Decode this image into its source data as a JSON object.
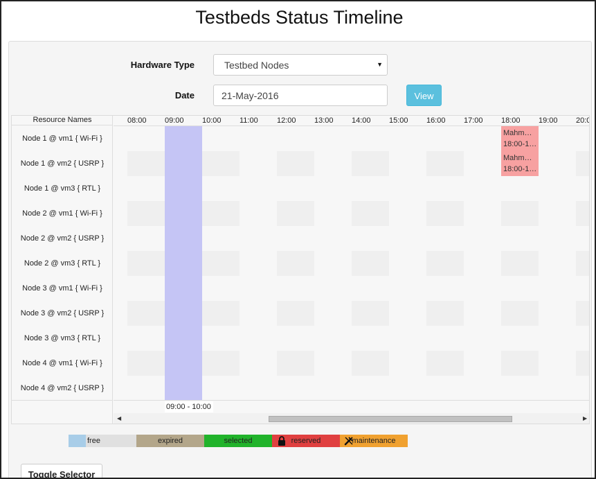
{
  "page": {
    "title": "Testbeds Status Timeline"
  },
  "form": {
    "hardware_type_label": "Hardware Type",
    "hardware_type_value": "Testbed Nodes",
    "date_label": "Date",
    "date_value": "21-May-2016",
    "view_button": "View"
  },
  "timeline": {
    "names_header": "Resource Names",
    "hours": [
      "08:00",
      "09:00",
      "10:00",
      "11:00",
      "12:00",
      "13:00",
      "14:00",
      "15:00",
      "16:00",
      "17:00",
      "18:00",
      "19:00",
      "20:0"
    ],
    "resources": [
      "Node 1 @ vm1 { Wi-Fi }",
      "Node 1 @ vm2 { USRP }",
      "Node 1 @ vm3 { RTL }",
      "Node 2 @ vm1 { Wi-Fi }",
      "Node 2 @ vm2 { USRP }",
      "Node 2 @ vm3 { RTL }",
      "Node 3 @ vm1 { Wi-Fi }",
      "Node 3 @ vm2 { USRP }",
      "Node 3 @ vm3 { RTL }",
      "Node 4 @ vm1 { Wi-Fi }",
      "Node 4 @ vm2 { USRP }"
    ],
    "reservations": [
      {
        "row": 0,
        "owner": "Mahm…",
        "time": "18:00-1…"
      },
      {
        "row": 1,
        "owner": "Mahm…",
        "time": "18:00-1…"
      }
    ],
    "selection_label": "09:00 - 10:00"
  },
  "legend": {
    "free": "free",
    "expired": "expired",
    "selected": "selected",
    "reserved": "reserved",
    "maintenance": "maintenance"
  },
  "toggle_button": "Toggle Selector",
  "colors": {
    "selected_column": "#c5c5f5",
    "reserved_cell": "#f7a1a1",
    "view_button": "#5bc0de",
    "legend_free": "#a8cde8",
    "legend_expired": "#b3a68a",
    "legend_selected": "#21b32b",
    "legend_reserved": "#e04040",
    "legend_maintenance": "#f0a130"
  },
  "icons": {
    "select_arrow": "caret-down-icon",
    "reserved": "lock-icon",
    "maintenance": "wrench-icon",
    "scroll_left": "arrow-left-icon",
    "scroll_right": "arrow-right-icon"
  }
}
